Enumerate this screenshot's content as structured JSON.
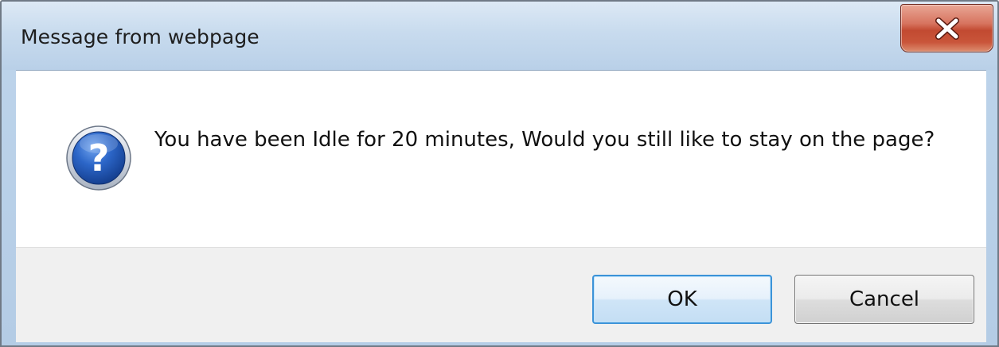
{
  "dialog": {
    "title": "Message from webpage",
    "message": "You have been Idle for 20 minutes, Would you still like to stay on the page?",
    "icon": "question-icon"
  },
  "buttons": {
    "ok_label": "OK",
    "cancel_label": "Cancel"
  },
  "window_controls": {
    "close_icon": "close-icon"
  },
  "colors": {
    "close_button": "#c9553a",
    "ok_border": "#3c93d8",
    "icon_blue": "#1d56b8"
  }
}
